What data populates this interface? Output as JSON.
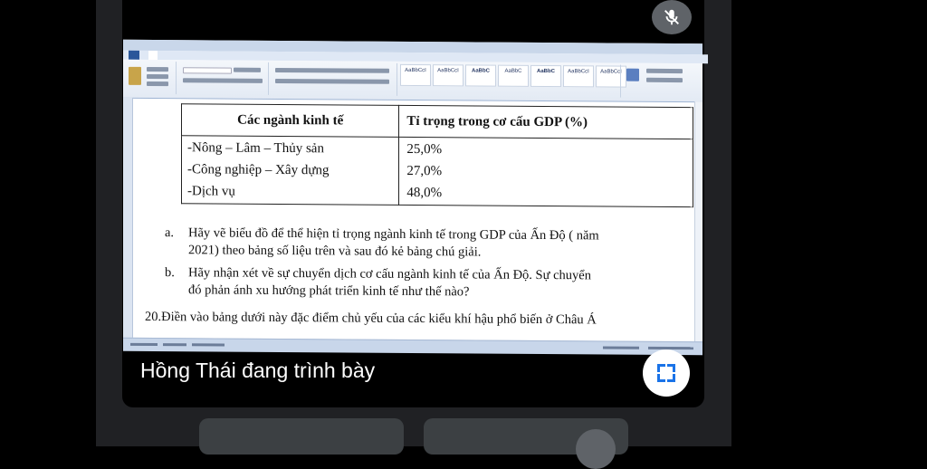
{
  "meeting": {
    "presenter_caption": "Hồng Thái đang trình bày"
  },
  "word": {
    "table": {
      "headers": [
        "Các ngành kinh tế",
        "Tỉ trọng trong cơ cấu GDP (%)"
      ],
      "rows": [
        [
          "-Nông – Lâm – Thủy sản",
          "25,0%"
        ],
        [
          "-Công nghiệp – Xây dựng",
          "27,0%"
        ],
        [
          "-Dịch vụ",
          "48,0%"
        ]
      ]
    },
    "questions": {
      "a": {
        "marker": "a.",
        "line1": "Hãy vẽ biểu đồ để thể hiện tỉ trọng  ngành kinh tế trong GDP của Ấn Độ ( năm",
        "line2": "2021) theo bảng số liệu trên  và sau đó kẻ bảng chú giải."
      },
      "b": {
        "marker": "b.",
        "line1": "Hãy nhận xét  về sự chuyển dịch cơ cấu ngành kinh tế của Ấn Độ. Sự chuyển",
        "line2": "đó phản ánh xu hướng phát triển kinh tế như thế nào?"
      },
      "q20": "20.Điền vào bảng dưới này đặc điểm chủ yếu của các kiểu khí hậu phổ biến ở Châu Á"
    },
    "style_gallery": [
      "AaBbCcI",
      "AaBbCcI",
      "AaBbC",
      "AaBbC",
      "AaBbC",
      "AaBbCcI",
      "AaBbCcI"
    ]
  },
  "icons": {
    "mic_off": "mic-off-icon",
    "fullscreen": "fullscreen-icon"
  },
  "colors": {
    "word_blue": "#2b579a",
    "meet_bg": "#202124",
    "accent_blue": "#1a73e8"
  }
}
